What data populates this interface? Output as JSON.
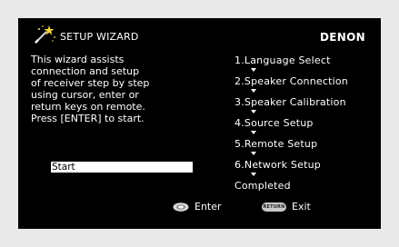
{
  "header": {
    "title": "SETUP WIZARD",
    "brand": "DENON",
    "icon": "magic-wand-icon"
  },
  "intro": {
    "lines": [
      "This wizard assists",
      "connection and setup",
      "of receiver step by step",
      "using cursor, enter or",
      "return keys on remote.",
      "Press [ENTER] to start."
    ]
  },
  "start_button": {
    "label": "Start"
  },
  "steps": [
    {
      "label": "1.Language Select"
    },
    {
      "label": "2.Speaker Connection"
    },
    {
      "label": "3.Speaker Calibration"
    },
    {
      "label": "4.Source Setup"
    },
    {
      "label": "5.Remote Setup"
    },
    {
      "label": "6.Network Setup"
    },
    {
      "label": "Completed"
    }
  ],
  "footer": {
    "enter_label": "Enter",
    "return_key_label": "RETURN",
    "exit_label": "Exit"
  },
  "colors": {
    "screen_background": "#000000",
    "frame_background": "#e9e9e9",
    "text": "#ffffff",
    "selection": "#ffffff"
  }
}
